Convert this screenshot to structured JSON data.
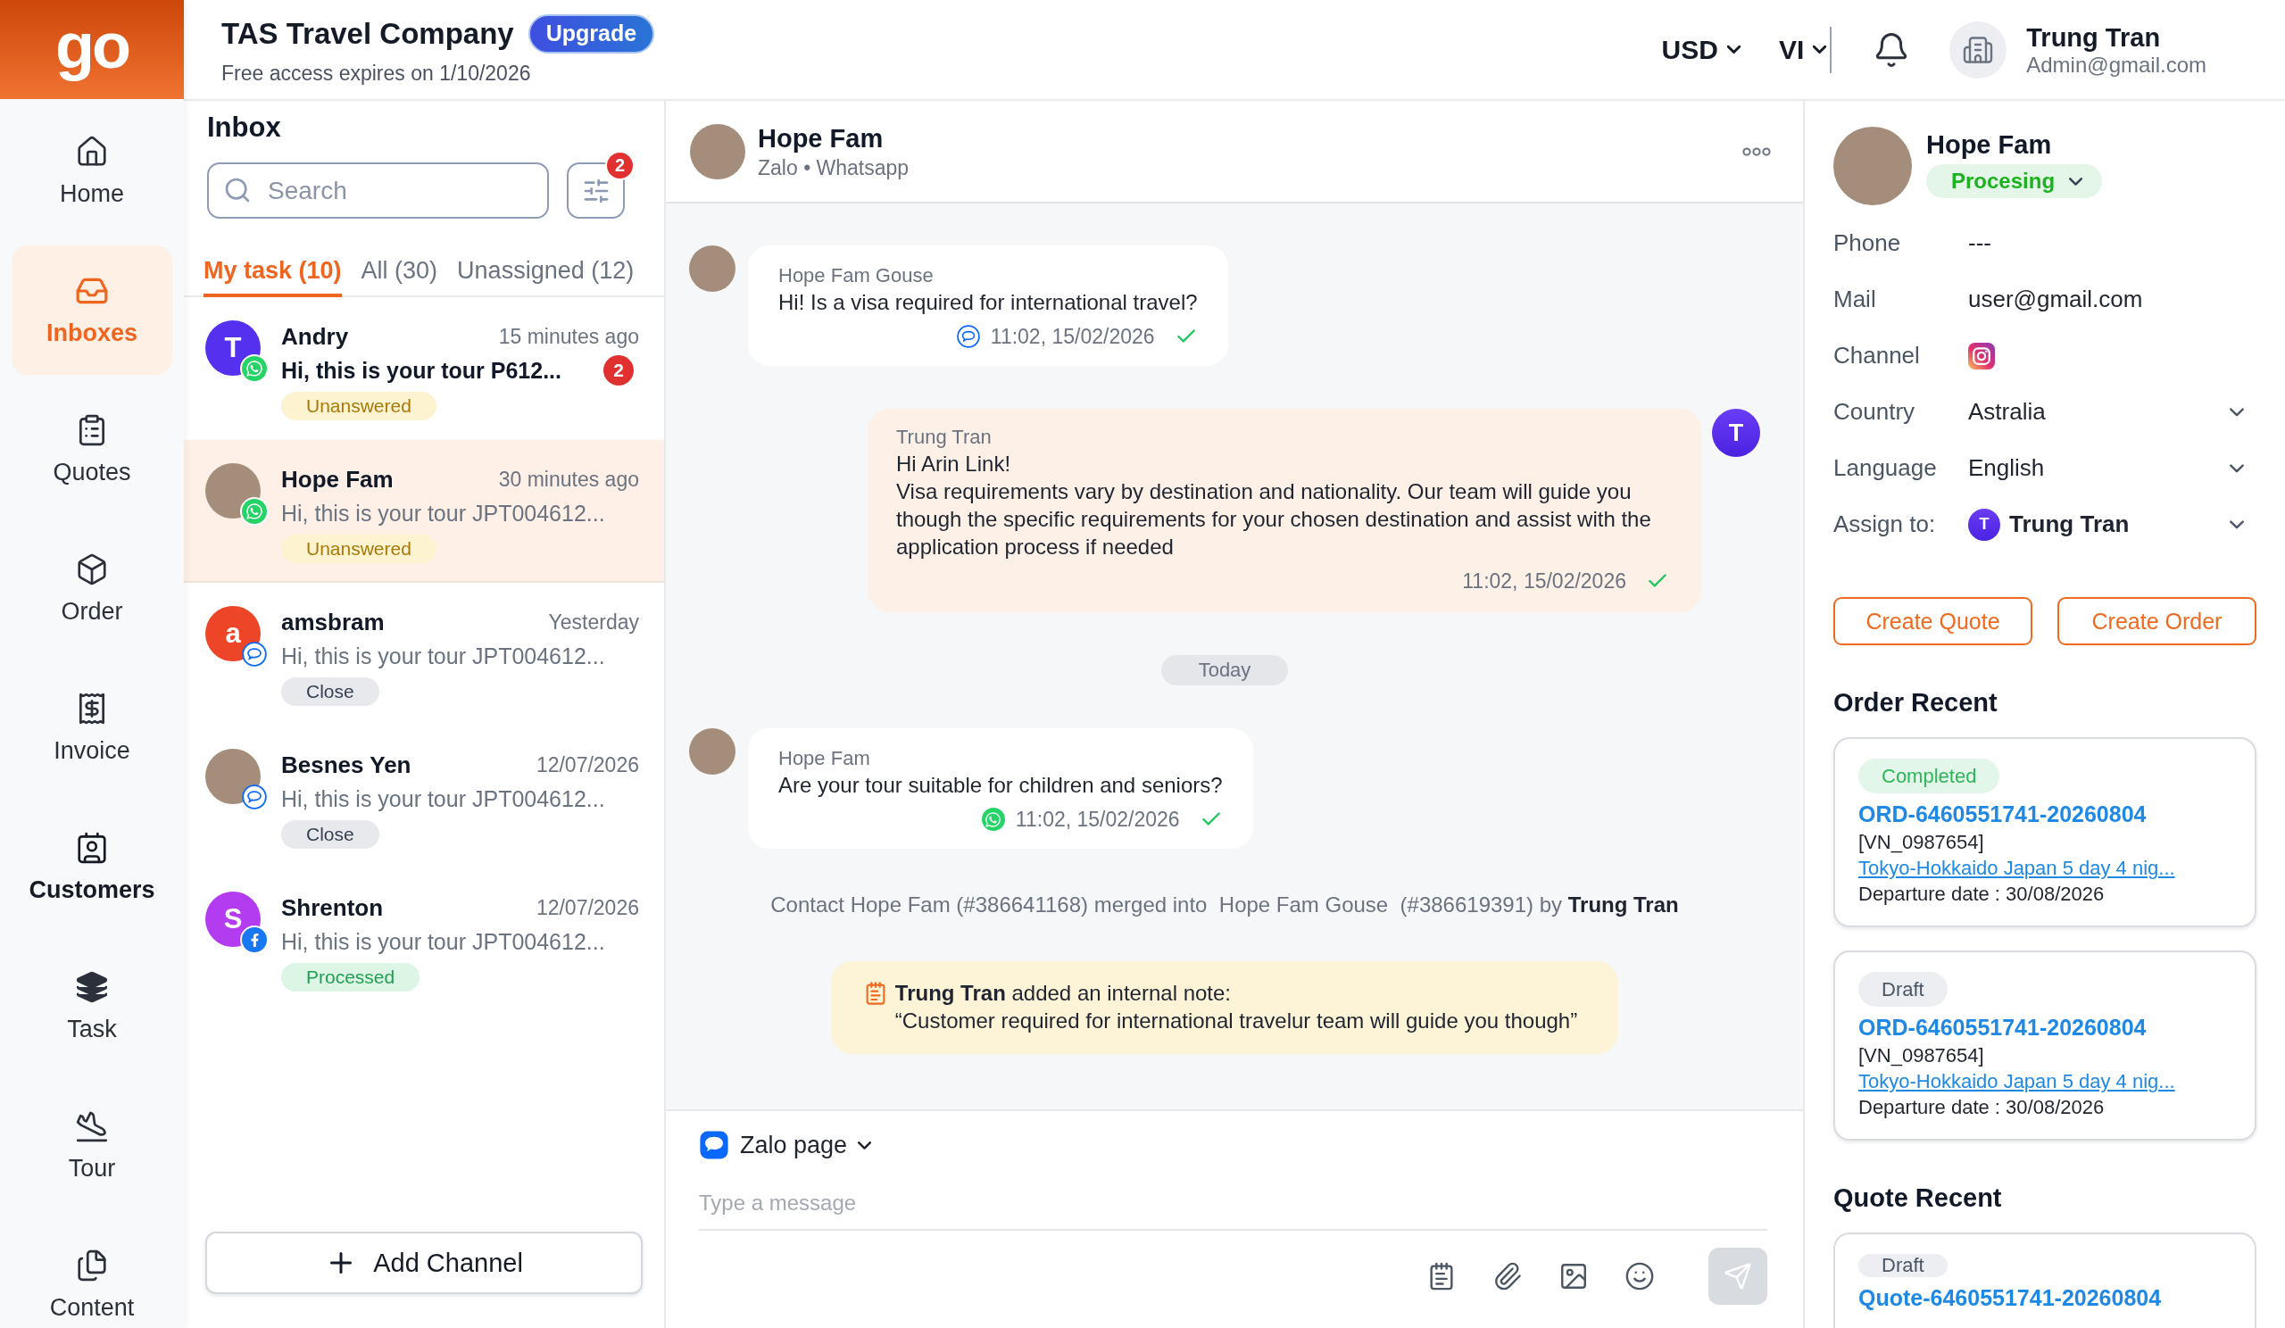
{
  "logo": "go",
  "header": {
    "company": "TAS Travel Company",
    "upgrade": "Upgrade",
    "expiry": "Free access expires on 1/10/2026",
    "currency": "USD",
    "language": "VI",
    "user": {
      "name": "Trung Tran",
      "email": "Admin@gmail.com"
    }
  },
  "nav": [
    {
      "label": "Home",
      "kind": "home",
      "selected": false,
      "hovered": false
    },
    {
      "label": "Inboxes",
      "kind": "inbox",
      "selected": true,
      "hovered": false
    },
    {
      "label": "Quotes",
      "kind": "quotes",
      "selected": false,
      "hovered": false
    },
    {
      "label": "Order",
      "kind": "order",
      "selected": false,
      "hovered": false
    },
    {
      "label": "Invoice",
      "kind": "invoice",
      "selected": false,
      "hovered": false
    },
    {
      "label": "Customers",
      "kind": "customers",
      "selected": false,
      "hovered": true
    },
    {
      "label": "Task",
      "kind": "task",
      "selected": false,
      "hovered": false
    },
    {
      "label": "Tour",
      "kind": "tour",
      "selected": false,
      "hovered": false
    },
    {
      "label": "Content",
      "kind": "content",
      "selected": false,
      "hovered": false
    }
  ],
  "inbox": {
    "title": "Inbox",
    "search": {
      "placeholder": "Search"
    },
    "filter_badge": "2",
    "tabs": [
      {
        "label": "My task (10)",
        "selected": true
      },
      {
        "label": "All (30)",
        "selected": false
      },
      {
        "label": "Unassigned (12)",
        "selected": false
      }
    ],
    "conversations": [
      {
        "name": "Andry",
        "time": "15 minutes ago",
        "preview": "Hi, this is your tour P612...",
        "unread": true,
        "unread_count": "2",
        "status": {
          "label": "Unanswered",
          "kind": "unanswered"
        },
        "channel": {
          "kind": "whatsapp"
        },
        "avatar": {
          "kind": "letter",
          "letter": "T",
          "color": "#5530ee"
        },
        "selected": false
      },
      {
        "name": "Hope Fam",
        "time": "30 minutes ago",
        "preview": "Hi, this is your tour JPT004612...",
        "unread": false,
        "status": {
          "label": "Unanswered",
          "kind": "unanswered"
        },
        "channel": {
          "kind": "whatsapp"
        },
        "avatar": {
          "kind": "photo"
        },
        "selected": true
      },
      {
        "name": "amsbram",
        "time": "Yesterday",
        "preview": "Hi, this is your tour JPT004612...",
        "unread": false,
        "status": {
          "label": "Close",
          "kind": "closed"
        },
        "channel": {
          "kind": "zalo"
        },
        "avatar": {
          "kind": "letter",
          "letter": "a",
          "color": "#ec4527"
        },
        "selected": false
      },
      {
        "name": "Besnes Yen",
        "time": "12/07/2026",
        "preview": "Hi, this is your tour JPT004612...",
        "unread": false,
        "status": {
          "label": "Close",
          "kind": "closed"
        },
        "channel": {
          "kind": "zalo"
        },
        "avatar": {
          "kind": "photo"
        },
        "selected": false
      },
      {
        "name": "Shrenton",
        "time": "12/07/2026",
        "preview": "Hi, this is your tour JPT004612...",
        "unread": false,
        "status": {
          "label": "Processed",
          "kind": "processed"
        },
        "channel": {
          "kind": "facebook"
        },
        "avatar": {
          "kind": "letter",
          "letter": "S",
          "color": "#b43cf0"
        },
        "selected": false
      }
    ],
    "add_channel": "Add Channel"
  },
  "chat": {
    "contact": {
      "name": "Hope Fam",
      "channels": "Zalo • Whatsapp"
    },
    "messages": [
      {
        "kind": "incoming",
        "sender": "Hope Fam Gouse",
        "lines": [
          "Hi! Is a visa required for international travel?"
        ],
        "channel": {
          "kind": "zalo"
        },
        "time": "11:02, 15/02/2026",
        "delivered": true
      },
      {
        "kind": "outgoing",
        "sender": "Trung Tran",
        "avatar": "T",
        "lines": [
          "Hi Arin Link!",
          "Visa requirements vary by destination and nationality. Our team will guide you though the specific requirements for your chosen destination and assist with the application process if needed"
        ],
        "time": "11:02, 15/02/2026",
        "delivered": true
      },
      {
        "kind": "date",
        "label": "Today"
      },
      {
        "kind": "incoming",
        "sender": "Hope Fam",
        "lines": [
          "Are your tour suitable for children and seniors?"
        ],
        "channel": {
          "kind": "whatsapp"
        },
        "time": "11:02, 15/02/2026",
        "delivered": true
      },
      {
        "kind": "event",
        "text": "Contact Hope Fam (#386641168) merged into  Hope Fam Gouse  (#386619391) by **Trung Tran**"
      },
      {
        "kind": "note",
        "heading": "**Trung Tran** added an internal note:",
        "body": "“Customer required for international travelur team will guide you though”"
      }
    ],
    "composer": {
      "channel": "Zalo page",
      "placeholder": "Type a message"
    }
  },
  "contact_panel": {
    "name": "Hope Fam",
    "status": "Procesing",
    "fields": [
      {
        "label": "Phone",
        "kind": "text",
        "value": "---"
      },
      {
        "label": "Mail",
        "kind": "text",
        "value": "user@gmail.com"
      },
      {
        "label": "Channel",
        "kind": "channel",
        "channel": {
          "kind": "instagram"
        }
      },
      {
        "label": "Country",
        "kind": "select",
        "value": "Astralia"
      },
      {
        "label": "Language",
        "kind": "select",
        "value": "English"
      },
      {
        "label": "Assign to:",
        "kind": "assignee",
        "avatar": "T",
        "value": "Trung Tran"
      }
    ],
    "actions": [
      "Create Quote",
      "Create Order"
    ],
    "orders": {
      "title": "Order Recent",
      "items": [
        {
          "status": {
            "label": "Completed",
            "kind": "completed"
          },
          "id": "ORD-6460551741-20260804",
          "code": "[VN_0987654]",
          "tour": "Tokyo-Hokkaido Japan 5 day 4 nig...",
          "departure": "Departure date : 30/08/2026"
        },
        {
          "status": {
            "label": "Draft",
            "kind": "draft"
          },
          "id": "ORD-6460551741-20260804",
          "code": "[VN_0987654]",
          "tour": "Tokyo-Hokkaido Japan 5 day 4 nig...",
          "departure": "Departure date : 30/08/2026"
        }
      ]
    },
    "quotes": {
      "title": "Quote Recent",
      "items": [
        {
          "status": {
            "label": "Draft",
            "kind": "draft"
          },
          "id": "Quote-6460551741-20260804"
        }
      ]
    }
  }
}
